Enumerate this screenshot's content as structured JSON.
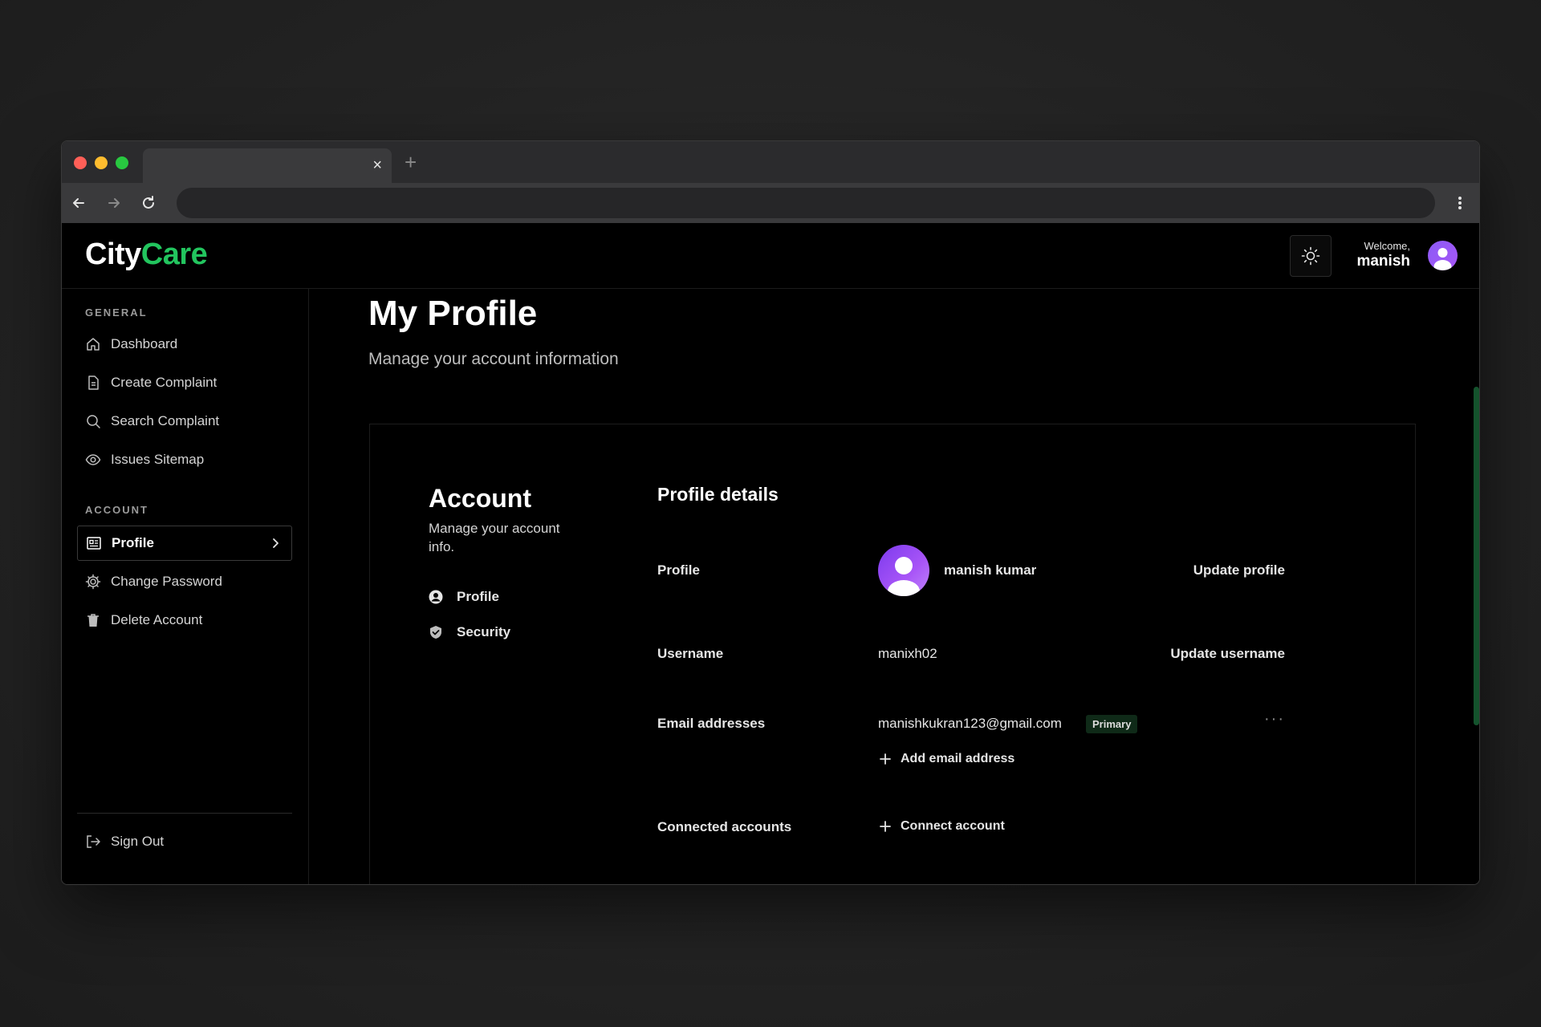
{
  "browser": {
    "tab_close_glyph": "×",
    "new_tab_glyph": "+"
  },
  "header": {
    "logo_city": "City",
    "logo_care": "Care",
    "welcome_label": "Welcome,",
    "welcome_name": "manish"
  },
  "sidebar": {
    "general_label": "GENERAL",
    "general_items": [
      {
        "label": "Dashboard",
        "icon": "home-icon"
      },
      {
        "label": "Create Complaint",
        "icon": "document-icon"
      },
      {
        "label": "Search Complaint",
        "icon": "search-icon"
      },
      {
        "label": "Issues Sitemap",
        "icon": "eye-icon"
      }
    ],
    "account_label": "ACCOUNT",
    "account_items": [
      {
        "label": "Profile",
        "icon": "profile-card-icon",
        "active": true
      },
      {
        "label": "Change Password",
        "icon": "gear-icon"
      },
      {
        "label": "Delete Account",
        "icon": "trash-icon"
      }
    ],
    "sign_out": "Sign Out"
  },
  "main": {
    "title": "My Profile",
    "subtitle": "Manage your account information"
  },
  "account_panel": {
    "title": "Account",
    "subtitle": "Manage your account info.",
    "nav": [
      {
        "label": "Profile",
        "icon": "user-circle-icon"
      },
      {
        "label": "Security",
        "icon": "shield-icon"
      }
    ]
  },
  "profile_details": {
    "title": "Profile details",
    "profile_label": "Profile",
    "profile_name": "manish kumar",
    "update_profile": "Update profile",
    "username_label": "Username",
    "username_value": "manixh02",
    "update_username": "Update username",
    "email_label": "Email addresses",
    "email_value": "manishkukran123@gmail.com",
    "email_badge": "Primary",
    "more_glyph": "···",
    "add_email": "Add email address",
    "connected_label": "Connected accounts",
    "connect_account": "Connect account"
  },
  "colors": {
    "accent_green": "#22c55e",
    "avatar_purple": "#8b5cf6",
    "badge_bg": "#0f2a18"
  }
}
